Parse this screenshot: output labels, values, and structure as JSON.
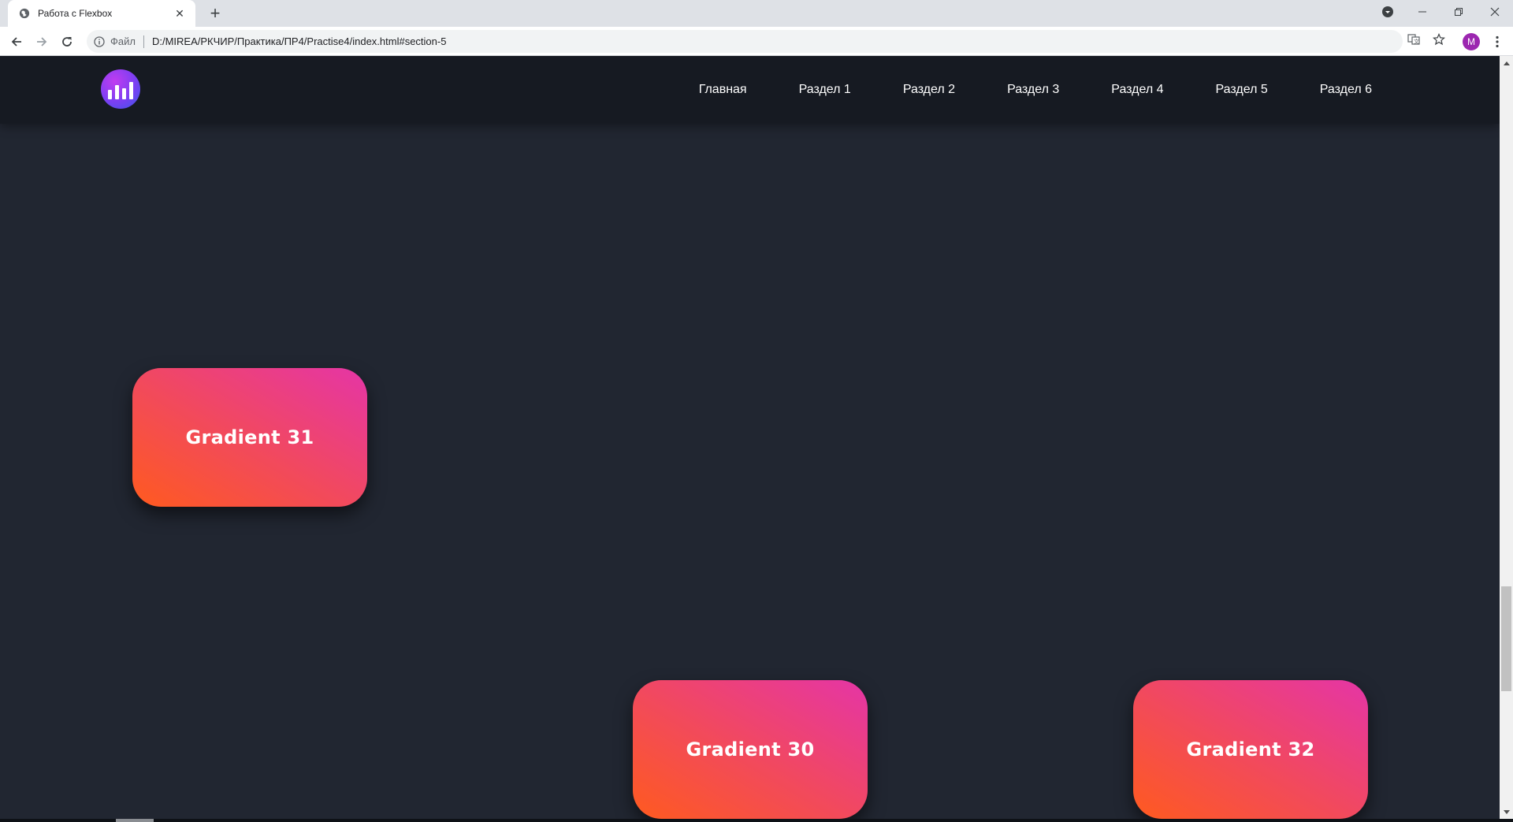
{
  "browser": {
    "tab_title": "Работа с Flexbox",
    "tab_close": "✕",
    "new_tab": "+",
    "scheme_label": "Файл",
    "url": "D:/MIREA/РКЧИР/Практика/ПР4/Practise4/index.html#section-5",
    "avatar_letter": "M"
  },
  "site": {
    "nav": [
      "Главная",
      "Раздел 1",
      "Раздел 2",
      "Раздел 3",
      "Раздел 4",
      "Раздел 5",
      "Раздел 6"
    ],
    "cards": [
      {
        "label": "Gradient 31"
      },
      {
        "label": "Gradient 30"
      },
      {
        "label": "Gradient 32"
      }
    ]
  },
  "colors": {
    "page_bg": "#212631",
    "header_bg": "#161a22",
    "gradient_start": "#ff5a1f",
    "gradient_end": "#e535a6"
  }
}
